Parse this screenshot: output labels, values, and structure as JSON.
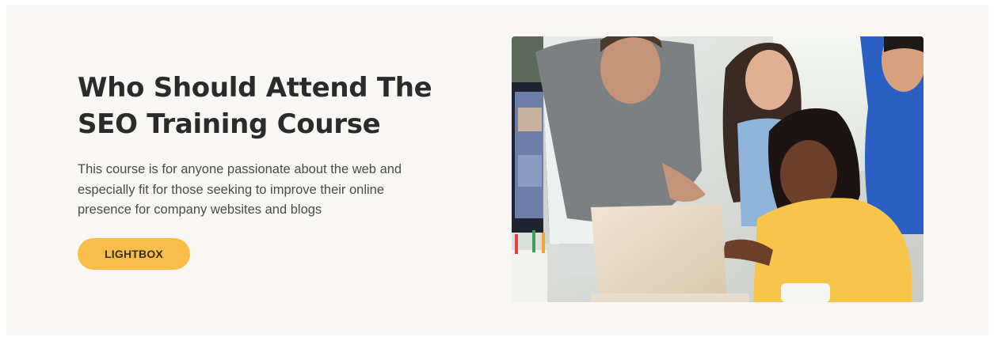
{
  "section": {
    "title": "Who Should Attend The SEO Training Course",
    "description": "This course is for anyone passionate about the web and especially fit for those seeking to improve their online presence for company websites and blogs",
    "button_label": "LIGHTBOX"
  },
  "colors": {
    "section_bg": "#f8f7f4",
    "title": "#2b2b2b",
    "body_text": "#4a4a4a",
    "button_bg": "#fbbd4a",
    "button_text": "#3a2e17"
  }
}
